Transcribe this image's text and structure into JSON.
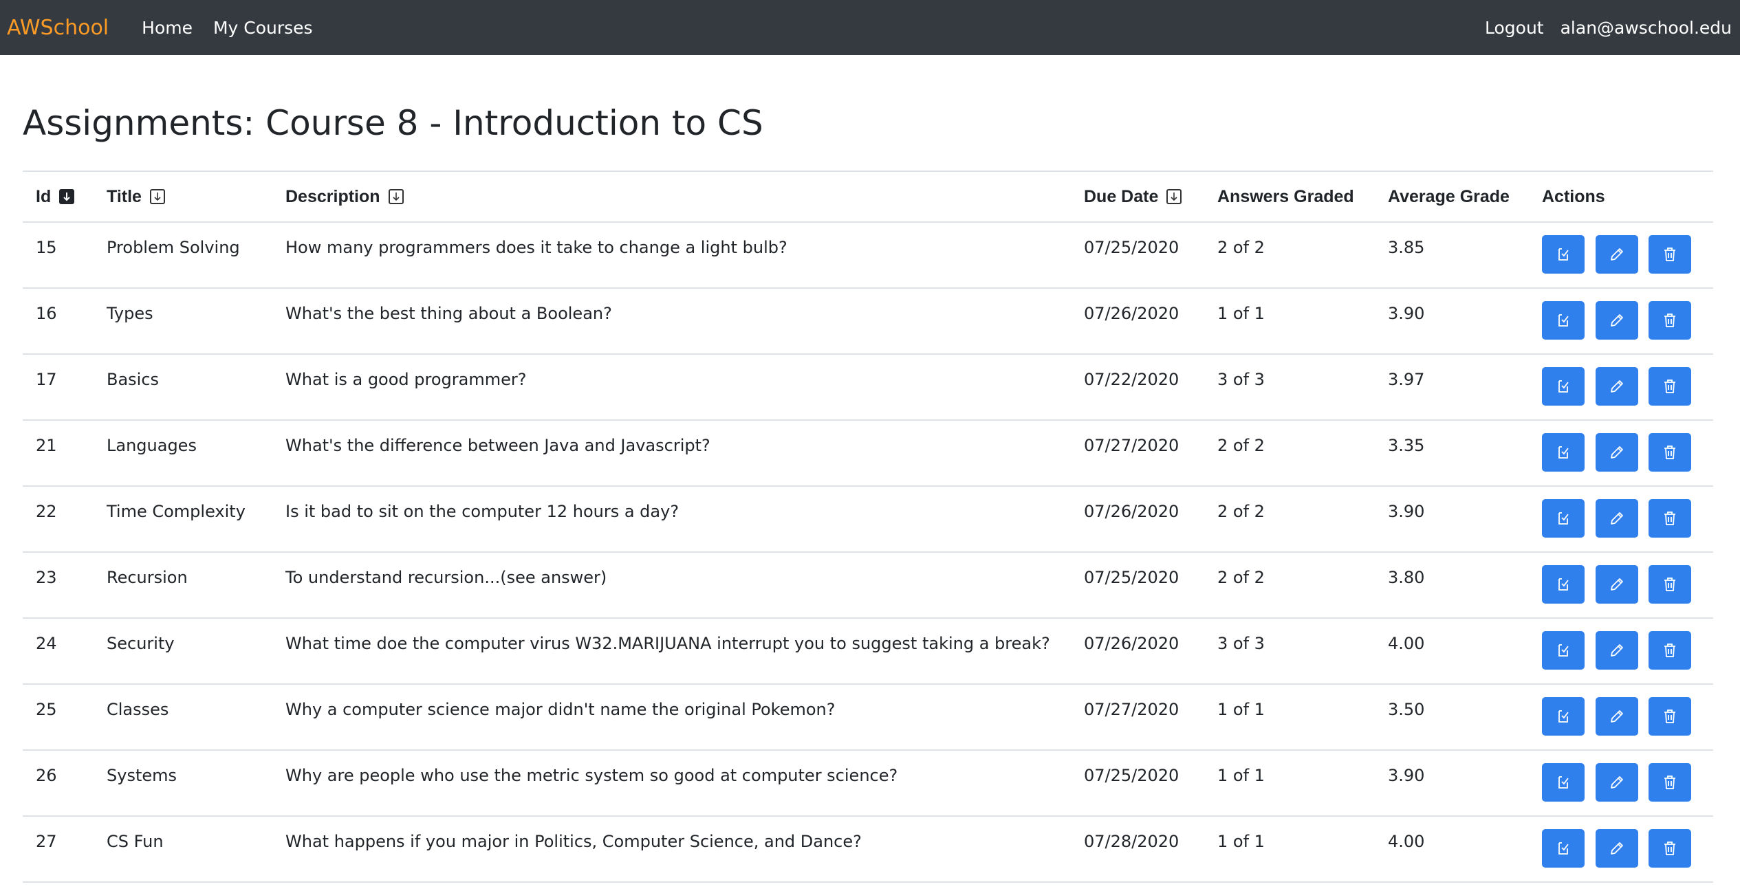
{
  "nav": {
    "brand": "AWSchool",
    "links": [
      "Home",
      "My Courses"
    ],
    "logout": "Logout",
    "user_email": "alan@awschool.edu"
  },
  "page": {
    "title": "Assignments: Course 8 - Introduction to CS"
  },
  "table": {
    "headers": {
      "id": "Id",
      "title": "Title",
      "description": "Description",
      "due_date": "Due Date",
      "answers_graded": "Answers Graded",
      "average_grade": "Average Grade",
      "actions": "Actions"
    },
    "rows": [
      {
        "id": "15",
        "title": "Problem Solving",
        "description": "How many programmers does it take to change a light bulb?",
        "due_date": "07/25/2020",
        "answers_graded": "2 of 2",
        "average_grade": "3.85"
      },
      {
        "id": "16",
        "title": "Types",
        "description": "What's the best thing about a Boolean?",
        "due_date": "07/26/2020",
        "answers_graded": "1 of 1",
        "average_grade": "3.90"
      },
      {
        "id": "17",
        "title": "Basics",
        "description": "What is a good programmer?",
        "due_date": "07/22/2020",
        "answers_graded": "3 of 3",
        "average_grade": "3.97"
      },
      {
        "id": "21",
        "title": "Languages",
        "description": "What's the difference between Java and Javascript?",
        "due_date": "07/27/2020",
        "answers_graded": "2 of 2",
        "average_grade": "3.35"
      },
      {
        "id": "22",
        "title": "Time Complexity",
        "description": "Is it bad to sit on the computer 12 hours a day?",
        "due_date": "07/26/2020",
        "answers_graded": "2 of 2",
        "average_grade": "3.90"
      },
      {
        "id": "23",
        "title": "Recursion",
        "description": "To understand recursion...(see answer)",
        "due_date": "07/25/2020",
        "answers_graded": "2 of 2",
        "average_grade": "3.80"
      },
      {
        "id": "24",
        "title": "Security",
        "description": "What time doe the computer virus W32.MARIJUANA interrupt you to suggest taking a break?",
        "due_date": "07/26/2020",
        "answers_graded": "3 of 3",
        "average_grade": "4.00"
      },
      {
        "id": "25",
        "title": "Classes",
        "description": "Why a computer science major didn't name the original Pokemon?",
        "due_date": "07/27/2020",
        "answers_graded": "1 of 1",
        "average_grade": "3.50"
      },
      {
        "id": "26",
        "title": "Systems",
        "description": "Why are people who use the metric system so good at computer science?",
        "due_date": "07/25/2020",
        "answers_graded": "1 of 1",
        "average_grade": "3.90"
      },
      {
        "id": "27",
        "title": "CS Fun",
        "description": "What happens if you major in Politics, Computer Science, and Dance?",
        "due_date": "07/28/2020",
        "answers_graded": "1 of 1",
        "average_grade": "4.00"
      }
    ],
    "row_action_icons": [
      "grade-icon",
      "pencil-icon",
      "trash-icon"
    ]
  },
  "colors": {
    "navbar_bg": "#343a40",
    "brand": "#fd9b26",
    "action_button": "#2f80ed"
  }
}
